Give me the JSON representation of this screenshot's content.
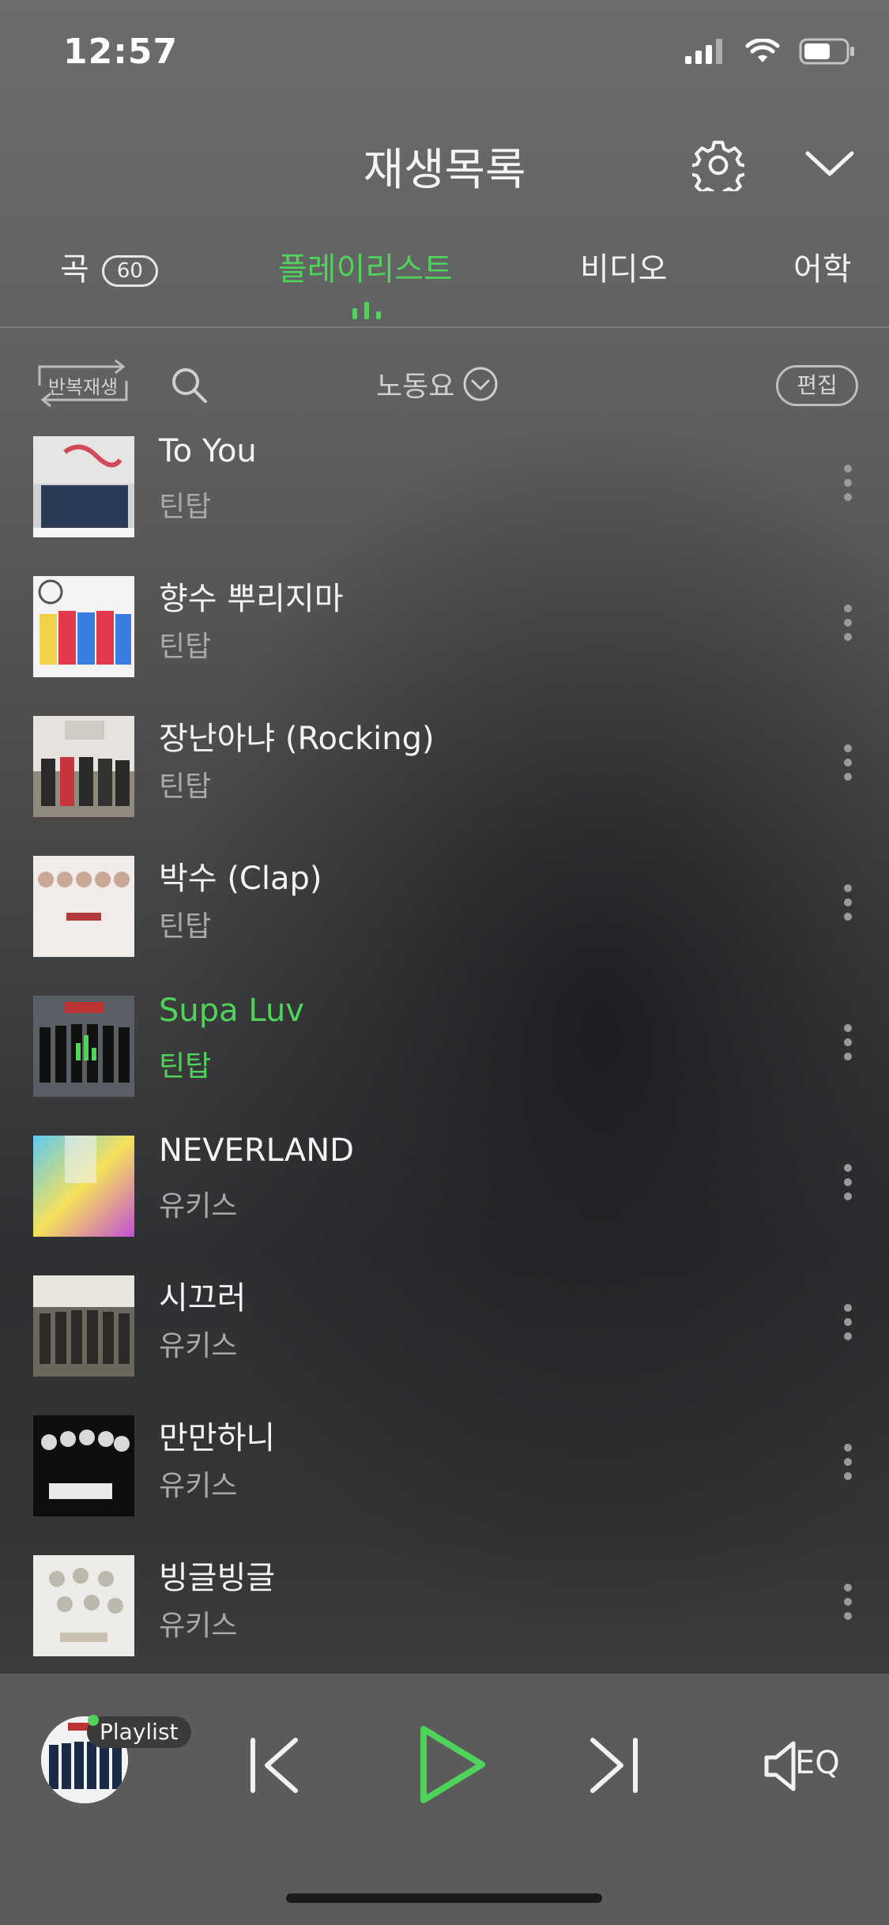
{
  "status": {
    "time": "12:57"
  },
  "header": {
    "title": "재생목록"
  },
  "tabs": [
    {
      "label": "곡",
      "count": "60"
    },
    {
      "label": "플레이리스트"
    },
    {
      "label": "비디오"
    },
    {
      "label": "어학"
    }
  ],
  "toolbar": {
    "repeat_label": "반복재생",
    "filter_label": "노동요",
    "edit_label": "편집"
  },
  "songs": [
    {
      "title": "To You",
      "artist": "틴탑"
    },
    {
      "title": "향수 뿌리지마",
      "artist": "틴탑"
    },
    {
      "title": "장난아냐 (Rocking)",
      "artist": "틴탑"
    },
    {
      "title": "박수 (Clap)",
      "artist": "틴탑"
    },
    {
      "title": "Supa Luv",
      "artist": "틴탑",
      "playing": true
    },
    {
      "title": "NEVERLAND",
      "artist": "유키스"
    },
    {
      "title": "시끄러",
      "artist": "유키스"
    },
    {
      "title": "만만하니",
      "artist": "유키스"
    },
    {
      "title": "빙글빙글",
      "artist": "유키스"
    }
  ],
  "player": {
    "badge": "Playlist",
    "eq_label": "EQ"
  },
  "colors": {
    "accent": "#4fd35a"
  }
}
